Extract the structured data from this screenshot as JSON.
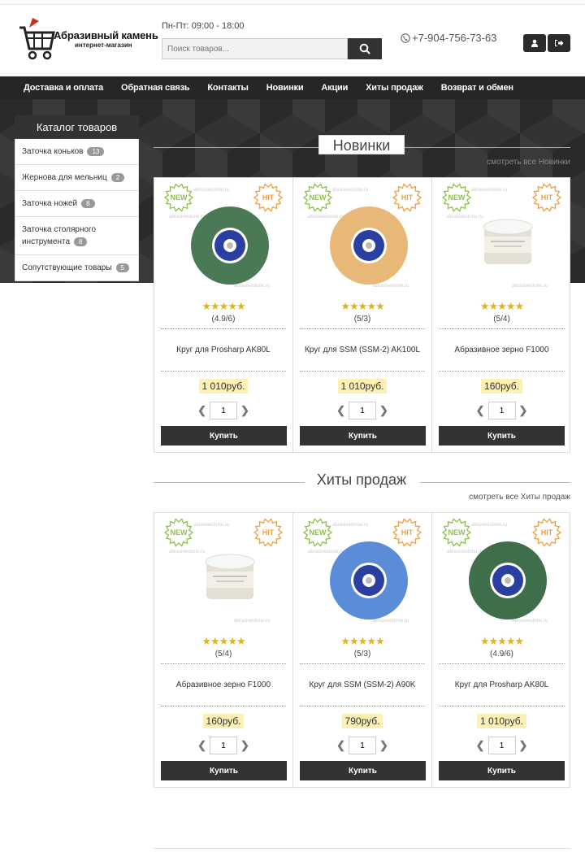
{
  "header": {
    "logo_title": "Абразивный камень",
    "logo_subtitle": "интернет-магазин",
    "hours": "Пн-Пт:  09:00 - 18:00",
    "search_placeholder": "Поиск товаров...",
    "phone": "+7-904-756-73-63"
  },
  "nav": [
    "Доставка и оплата",
    "Обратная связь",
    "Контакты",
    "Новинки",
    "Акции",
    "Хиты продаж",
    "Возврат и обмен"
  ],
  "catalog": {
    "title": "Каталог товаров",
    "items": [
      {
        "label": "Заточка коньков",
        "count": "13"
      },
      {
        "label": "Жернова для мельниц",
        "count": "2"
      },
      {
        "label": "Заточка ножей",
        "count": "8"
      },
      {
        "label": "Заточка столярного инструмента",
        "count": "8"
      },
      {
        "label": "Сопутствующие товары",
        "count": "5"
      }
    ]
  },
  "tags": {
    "new": "NEW",
    "hit": "HIT"
  },
  "watermark": "abrasivestone.ru",
  "sections": {
    "new": {
      "title": "Новинки",
      "see_all": "смотреть все Новинки",
      "products": [
        {
          "name": "Круг для Prosharp AK80L",
          "rating": "(4.9/6)",
          "price": "1 010руб.",
          "qty": "1",
          "buy": "Купить",
          "image": "wheel",
          "wheel_color": "#4a7a55"
        },
        {
          "name": "Круг для SSM (SSM-2) AK100L",
          "rating": "(5/3)",
          "price": "1 010руб.",
          "qty": "1",
          "buy": "Купить",
          "image": "wheel",
          "wheel_color": "#e8b878"
        },
        {
          "name": "Абразивное зерно F1000",
          "rating": "(5/4)",
          "price": "160руб.",
          "qty": "1",
          "buy": "Купить",
          "image": "jar"
        }
      ]
    },
    "hits": {
      "title": "Хиты продаж",
      "see_all": "смотреть все Хиты продаж",
      "products": [
        {
          "name": "Абразивное зерно F1000",
          "rating": "(5/4)",
          "price": "160руб.",
          "qty": "1",
          "buy": "Купить",
          "image": "jar"
        },
        {
          "name": "Круг для SSM (SSM-2) A90K",
          "rating": "(5/3)",
          "price": "790руб.",
          "qty": "1",
          "buy": "Купить",
          "image": "wheel",
          "wheel_color": "#5b8cd8"
        },
        {
          "name": "Круг для Prosharp AK80L",
          "rating": "(4.9/6)",
          "price": "1 010руб.",
          "qty": "1",
          "buy": "Купить",
          "image": "wheel",
          "wheel_color": "#3f6e4a"
        }
      ]
    }
  },
  "colors": {
    "accent_dark": "#333333",
    "price_bg": "#fdf0b5",
    "star": "#e0b520",
    "tag_new": "#8bc34a",
    "tag_hit": "#f0a040"
  }
}
